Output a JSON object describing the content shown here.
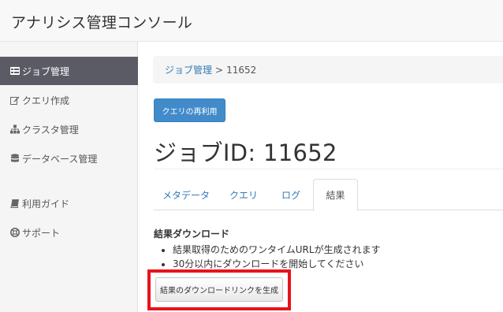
{
  "app": {
    "title": "アナリシス管理コンソール"
  },
  "sidebar": {
    "items": [
      {
        "label": "ジョブ管理",
        "icon": "list-icon",
        "active": true
      },
      {
        "label": "クエリ作成",
        "icon": "edit-icon",
        "active": false
      },
      {
        "label": "クラスタ管理",
        "icon": "sitemap-icon",
        "active": false
      },
      {
        "label": "データベース管理",
        "icon": "database-icon",
        "active": false
      },
      {
        "label": "利用ガイド",
        "icon": "book-icon",
        "active": false
      },
      {
        "label": "サポート",
        "icon": "lifebuoy-icon",
        "active": false
      }
    ]
  },
  "breadcrumb": {
    "parent": "ジョブ管理",
    "separator": ">",
    "current": "11652"
  },
  "buttons": {
    "reuse_query": "クエリの再利用",
    "generate_link": "結果のダウンロードリンクを生成"
  },
  "job": {
    "title": "ジョブID: 11652"
  },
  "tabs": [
    {
      "label": "メタデータ",
      "active": false
    },
    {
      "label": "クエリ",
      "active": false
    },
    {
      "label": "ログ",
      "active": false
    },
    {
      "label": "結果",
      "active": true
    }
  ],
  "download": {
    "heading": "結果ダウンロード",
    "bullets": [
      "結果取得のためのワンタイムURLが生成されます",
      "30分以内にダウンロードを開始してください"
    ]
  },
  "colors": {
    "primary": "#428bca",
    "link": "#337ab7",
    "active_nav": "#5b5b66",
    "highlight": "#e8131b"
  }
}
